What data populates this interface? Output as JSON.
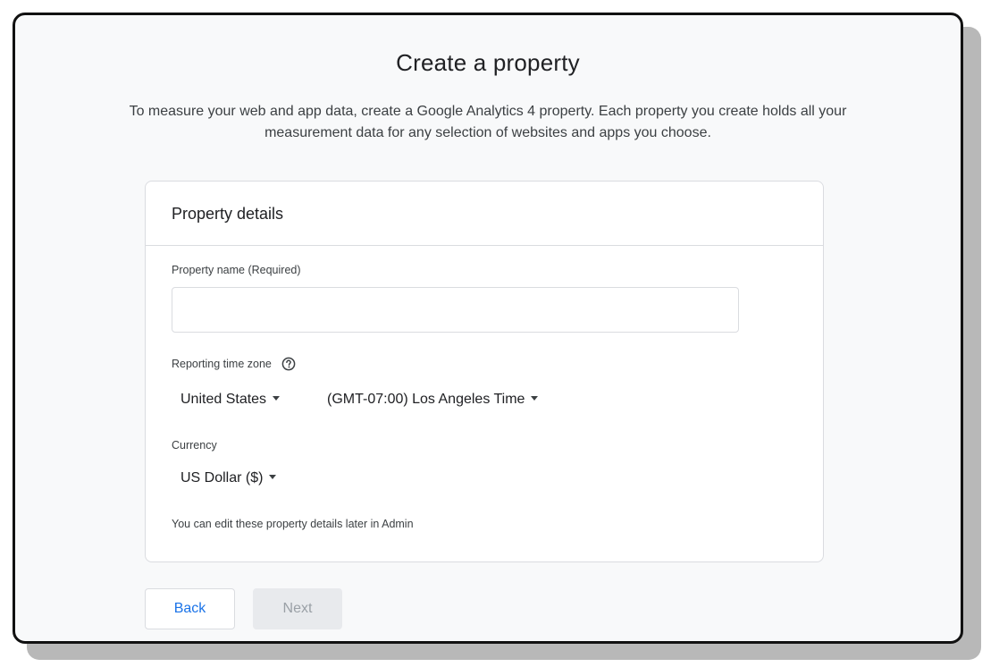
{
  "page": {
    "title": "Create a property",
    "subtitle_line1": "To measure your web and app data, create a Google Analytics 4 property. Each property you create holds all your",
    "subtitle_line2": "measurement data for any selection of websites and apps you choose."
  },
  "card": {
    "header": "Property details",
    "property_name": {
      "label": "Property name (Required)",
      "value": "",
      "placeholder": ""
    },
    "time_zone": {
      "label": "Reporting time zone",
      "help_icon": "help-circle-icon",
      "country": "United States",
      "zone": "(GMT-07:00) Los Angeles Time"
    },
    "currency": {
      "label": "Currency",
      "value": "US Dollar ($)"
    },
    "hint": "You can edit these property details later in Admin"
  },
  "buttons": {
    "back": "Back",
    "next": "Next"
  },
  "colors": {
    "accent": "#1a73e8",
    "background": "#f8f9fa",
    "border": "#dadce0",
    "disabled_bg": "#e8eaed",
    "disabled_text": "#9aa0a6"
  }
}
